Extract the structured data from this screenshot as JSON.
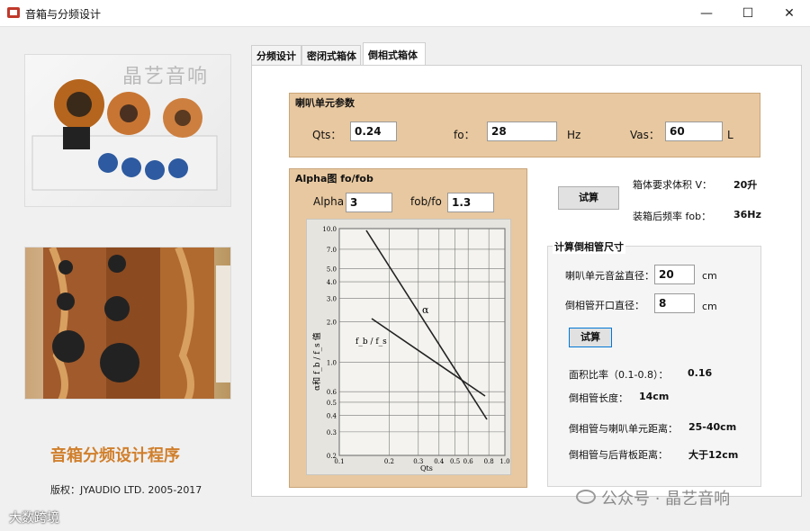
{
  "window": {
    "title": "音箱与分频设计",
    "min": "—",
    "max": "☐",
    "close": "✕"
  },
  "left": {
    "watermark_logo": "晶艺音响",
    "app_name": "音箱分频设计程序",
    "copyright": "版权：JYAUDIO LTD.  2005-2017"
  },
  "tabs": [
    {
      "label": "分频设计"
    },
    {
      "label": "密闭式箱体"
    },
    {
      "label": "倒相式箱体"
    }
  ],
  "params": {
    "legend": "喇叭单元参数",
    "qts_label": "Qts：",
    "qts_value": "0.24",
    "fo_label": "fo：",
    "fo_value": "28",
    "fo_unit": "Hz",
    "vas_label": "Vas：",
    "vas_value": "60",
    "vas_unit": "L"
  },
  "alpha": {
    "legend": "Alpha图 fo/fob",
    "alpha_label": "Alpha",
    "alpha_value": "3",
    "fobfo_label": "fob/fo",
    "fobfo_value": "1.3",
    "graph": {
      "y_ticks": [
        "10.0",
        "7.0",
        "5.0",
        "4.0",
        "3.0",
        "2.0",
        "1.0",
        "0.6",
        "0.5",
        "0.4",
        "0.3",
        "0.2"
      ],
      "x_ticks": [
        "0.1",
        "0.2",
        "0.3",
        "0.4",
        "0.5",
        "0.6",
        "0.8",
        "1.0"
      ],
      "xlabel": "Qts",
      "ylabel": "α和 f_b / f_s 值",
      "line_alpha_label": "α",
      "line_ratio_label": "f_b / f_s"
    }
  },
  "calc1": {
    "button": "试算",
    "volume_label": "箱体要求体积 V：",
    "volume_value": "20升",
    "fob_label": "装箱后频率 fob：",
    "fob_value": "36Hz"
  },
  "port": {
    "legend": "计算倒相管尺寸",
    "diam_label": "喇叭单元音盆直径：",
    "diam_value": "20",
    "diam_unit": "cm",
    "opening_label": "倒相管开口直径：",
    "opening_value": "8",
    "opening_unit": "cm",
    "button": "试算",
    "area_label": "面积比率（0.1-0.8）：",
    "area_value": "0.16",
    "length_label": "倒相管长度：",
    "length_value": "14cm",
    "dist_label": "倒相管与喇叭单元距离：",
    "dist_value": "25-40cm",
    "back_label": "倒相管与后背板距离：",
    "back_value": "大于12cm"
  },
  "watermarks": {
    "right": "公众号 · 晶艺音响",
    "left": "大数跨境"
  }
}
